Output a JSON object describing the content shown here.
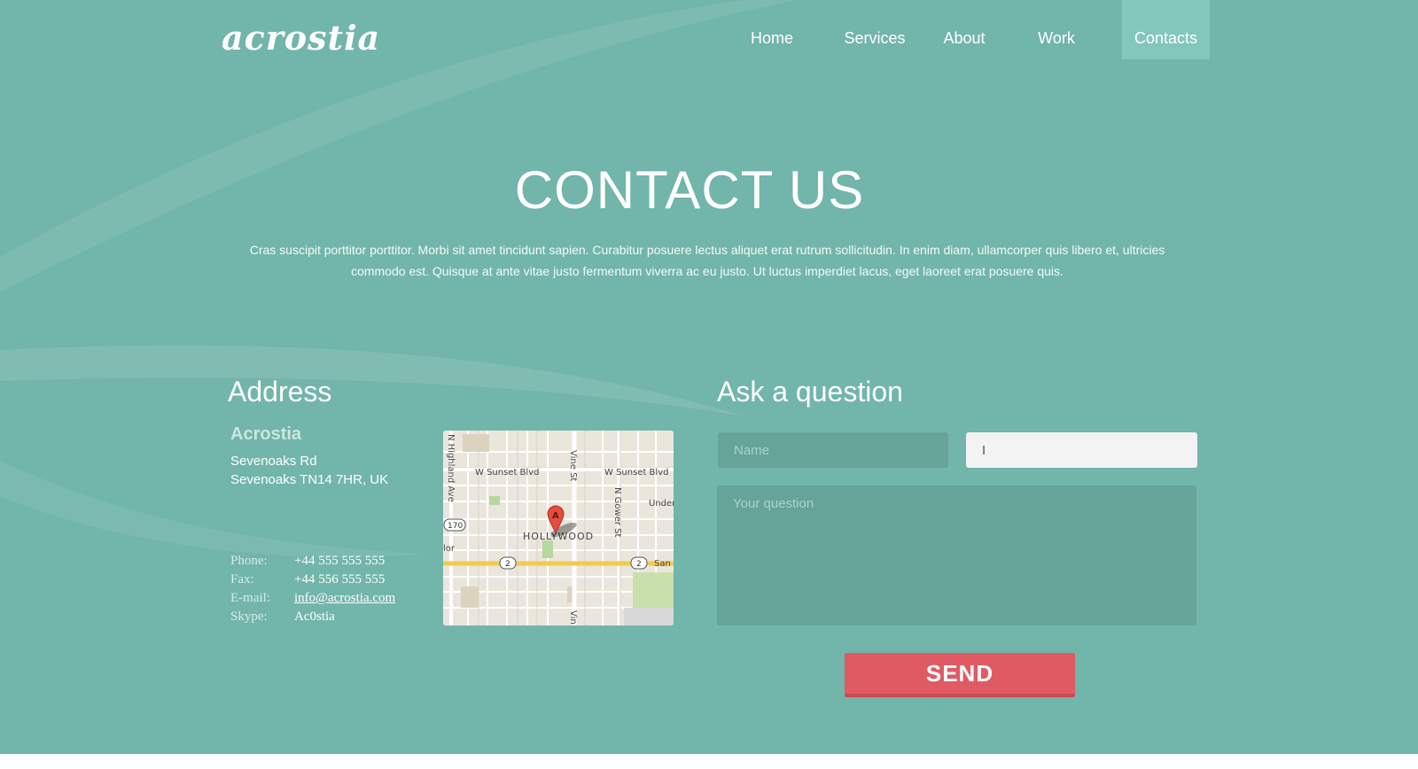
{
  "header": {
    "logo": "acrostia",
    "nav": [
      {
        "label": "Home"
      },
      {
        "label": "Services"
      },
      {
        "label": "About"
      },
      {
        "label": "Work"
      },
      {
        "label": "Contacts",
        "active": true
      }
    ]
  },
  "hero": {
    "title": "CONTACT US",
    "intro": "Cras suscipit porttitor porttitor. Morbi sit amet tincidunt sapien. Curabitur posuere lectus aliquet erat rutrum sollicitudin. In enim diam, ullamcorper quis libero et, ultricies commodo est. Quisque at ante vitae justo fermentum viverra ac eu justo. Ut luctus imperdiet lacus, eget laoreet erat posuere quis."
  },
  "address": {
    "heading": "Address",
    "company": "Acrostia",
    "street": "Sevenoaks Rd",
    "city": "Sevenoaks TN14 7HR, UK",
    "phone_label": "Phone:",
    "phone": "+44 555 555 555",
    "fax_label": "Fax:",
    "fax": "+44 556  555 555",
    "email_label": "E-mail:",
    "email": "info@acrostia.com",
    "skype_label": "Skype:",
    "skype": "Ac0stia"
  },
  "map": {
    "streets": [
      "W Sunset Blvd",
      "W Sunset Blvd",
      "N Highland Ave",
      "Vine St",
      "N Gower St",
      "Vin",
      "Under",
      "San",
      "lor"
    ],
    "district": "HOLLYWOOD",
    "marker": "A",
    "shields": [
      "170",
      "2",
      "2"
    ]
  },
  "form": {
    "heading": "Ask a question",
    "name_placeholder": "Name",
    "email_value": "I",
    "question_placeholder": "Your question",
    "send_label": "SEND"
  },
  "colors": {
    "background": "#72b5aa",
    "nav_active": "#83c6bb",
    "field_dark": "#66a398",
    "send": "#e05a64"
  }
}
